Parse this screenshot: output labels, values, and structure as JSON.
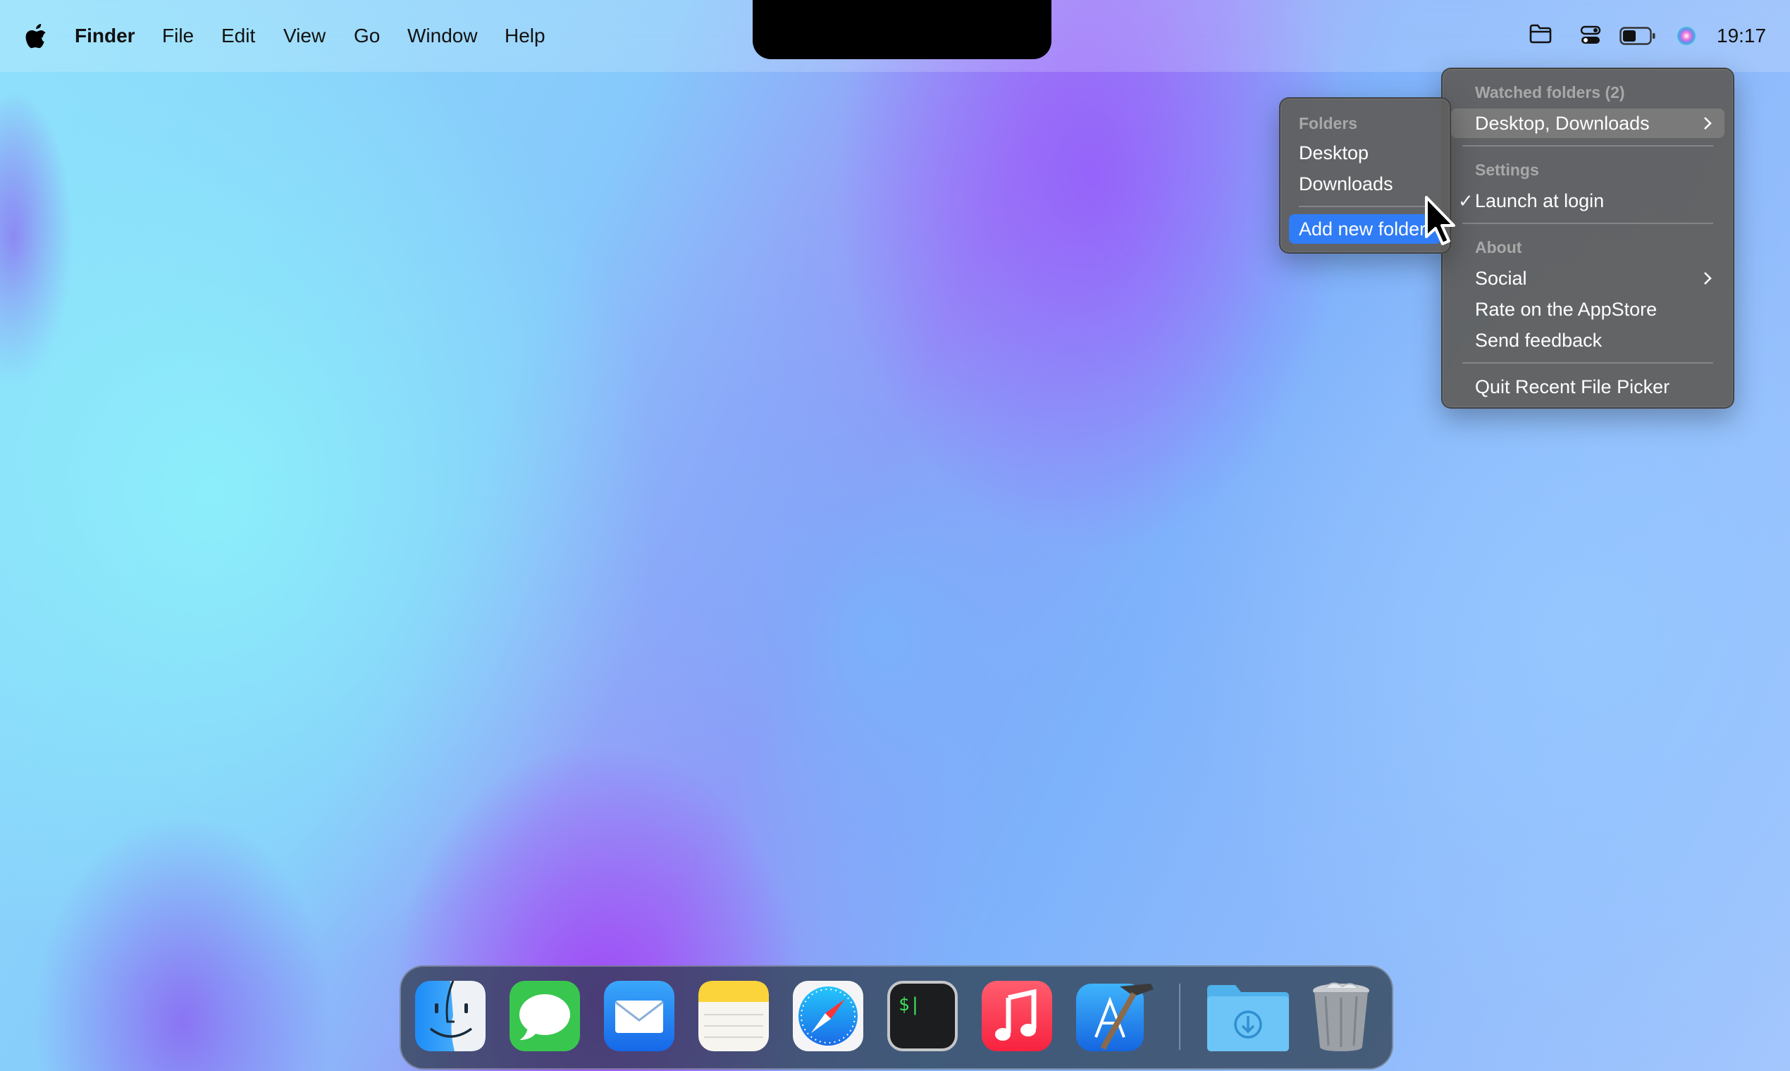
{
  "menubar": {
    "app_name": "Finder",
    "menus": [
      "File",
      "Edit",
      "View",
      "Go",
      "Window",
      "Help"
    ],
    "clock": "19:17",
    "status_icons": [
      "folder-icon",
      "control-center-icon",
      "battery-icon",
      "siri-icon"
    ]
  },
  "main_menu": {
    "watched_header": "Watched folders (2)",
    "watched_item": "Desktop, Downloads",
    "settings_header": "Settings",
    "launch_at_login": "Launch at login",
    "launch_checked": "✓",
    "about_header": "About",
    "social": "Social",
    "rate": "Rate on the AppStore",
    "feedback": "Send feedback",
    "quit": "Quit Recent File Picker"
  },
  "folders_submenu": {
    "header": "Folders",
    "items": [
      "Desktop",
      "Downloads"
    ],
    "add": "Add new folder"
  },
  "dock": {
    "apps": [
      "Finder",
      "Messages",
      "Mail",
      "Notes",
      "Safari",
      "Terminal",
      "Music",
      "Xcode",
      "Downloads",
      "Trash"
    ],
    "terminal_prompt": "$|"
  },
  "colors": {
    "highlight": "#2f7cf6",
    "hover": "#7a7a7a"
  }
}
